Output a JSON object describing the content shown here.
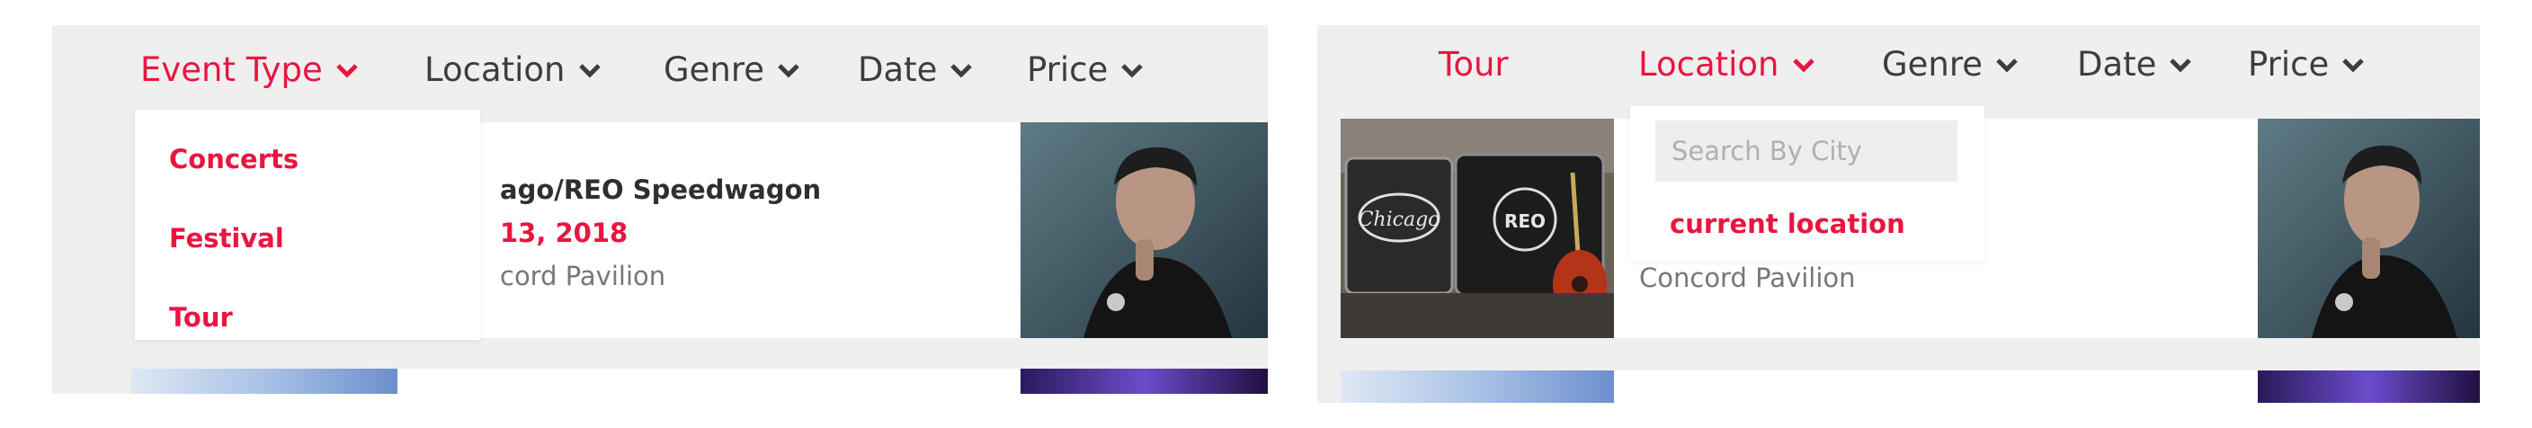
{
  "colors": {
    "accent": "#e8163f",
    "text": "#3d3d3d",
    "panel_bg": "#efefef",
    "card_bg": "#ffffff",
    "muted": "#777777"
  },
  "left": {
    "filters": [
      "Event Type",
      "Location",
      "Genre",
      "Date",
      "Price"
    ],
    "active_filter": "Event Type",
    "dropdown": {
      "items": [
        "Concerts",
        "Festival",
        "Tour"
      ]
    },
    "card": {
      "title": "ago/REO Speedwagon",
      "date": "13, 2018",
      "venue": "cord Pavilion"
    }
  },
  "right": {
    "filters": [
      "Tour",
      "Location",
      "Genre",
      "Date",
      "Price"
    ],
    "active_filter": "Location",
    "dropdown": {
      "search_placeholder": "Search By City",
      "current_location": "current location"
    },
    "card": {
      "venue": "Concord Pavilion"
    }
  },
  "icons": {
    "chevron": "chevron-down-icon",
    "case_logo_chicago": "Chicago",
    "case_logo_reo": "REO"
  }
}
